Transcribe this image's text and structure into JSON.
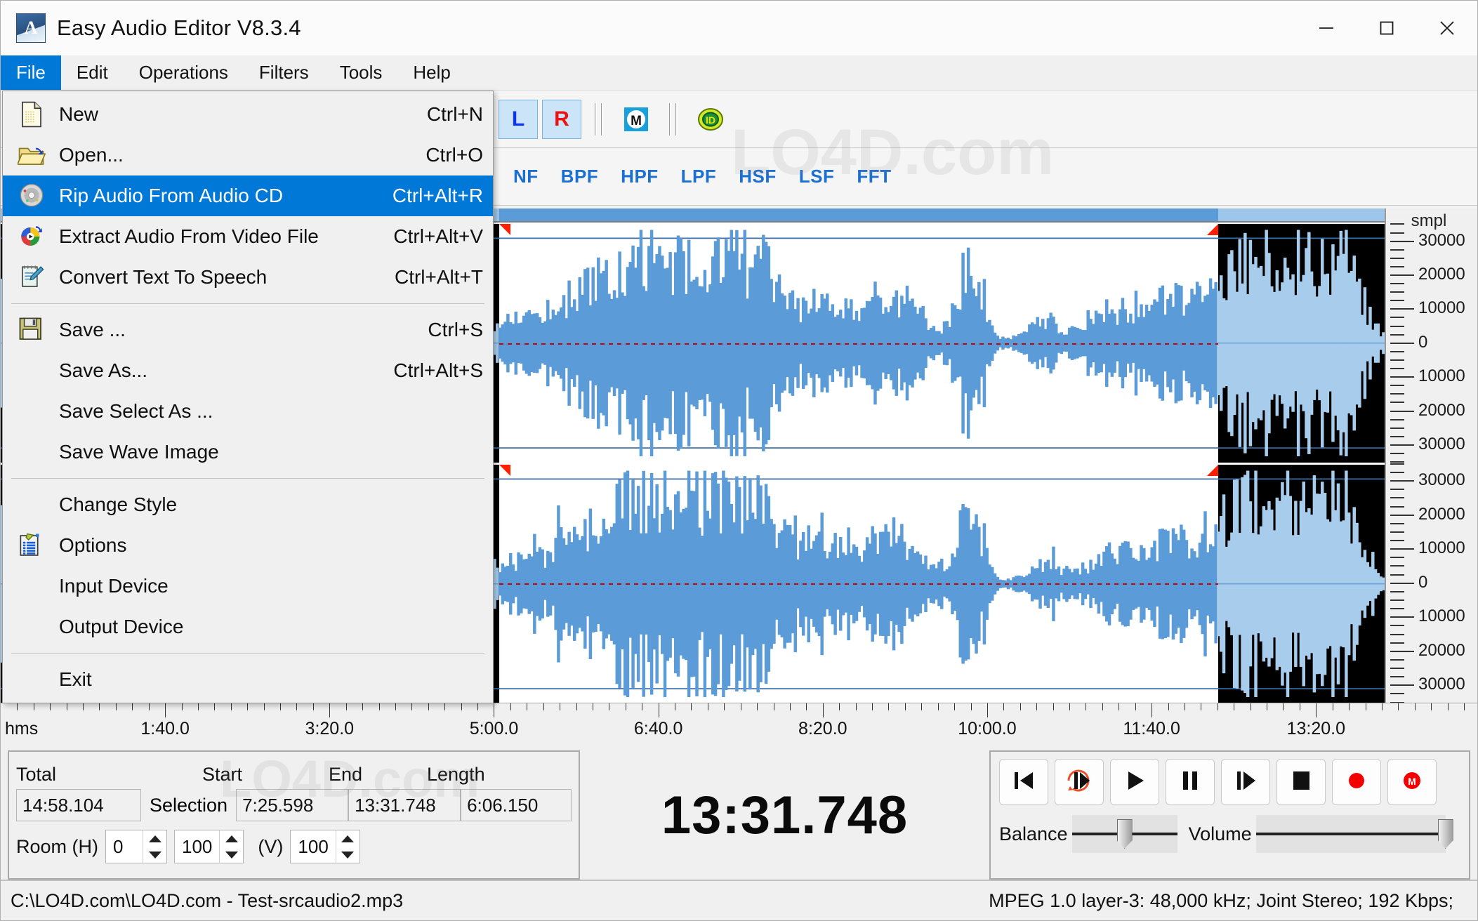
{
  "window": {
    "title": "Easy Audio Editor V8.3.4",
    "app_icon": "A",
    "minimize_icon": "minimize-icon",
    "maximize_icon": "maximize-icon",
    "close_icon": "close-icon"
  },
  "menubar": {
    "items": [
      {
        "label": "File",
        "active": true
      },
      {
        "label": "Edit",
        "active": false
      },
      {
        "label": "Operations",
        "active": false
      },
      {
        "label": "Filters",
        "active": false
      },
      {
        "label": "Tools",
        "active": false
      },
      {
        "label": "Help",
        "active": false
      }
    ]
  },
  "file_menu": {
    "open": true,
    "items": [
      {
        "type": "item",
        "icon": "new-document-icon",
        "label": "New",
        "accel": "Ctrl+N",
        "selected": false
      },
      {
        "type": "item",
        "icon": "open-folder-icon",
        "label": "Open...",
        "accel": "Ctrl+O",
        "selected": false
      },
      {
        "type": "item",
        "icon": "audio-cd-icon",
        "label": "Rip Audio From Audio CD",
        "accel": "Ctrl+Alt+R",
        "selected": true
      },
      {
        "type": "item",
        "icon": "video-file-icon",
        "label": "Extract Audio From Video File",
        "accel": "Ctrl+Alt+V",
        "selected": false
      },
      {
        "type": "item",
        "icon": "text-to-speech-icon",
        "label": "Convert Text To Speech",
        "accel": "Ctrl+Alt+T",
        "selected": false
      },
      {
        "type": "separator"
      },
      {
        "type": "item",
        "icon": "floppy-save-icon",
        "label": "Save ...",
        "accel": "Ctrl+S",
        "selected": false
      },
      {
        "type": "item",
        "icon": "",
        "label": "Save As...",
        "accel": "Ctrl+Alt+S",
        "selected": false
      },
      {
        "type": "item",
        "icon": "",
        "label": "Save Select As ...",
        "accel": "",
        "selected": false
      },
      {
        "type": "item",
        "icon": "",
        "label": "Save Wave Image",
        "accel": "",
        "selected": false
      },
      {
        "type": "separator"
      },
      {
        "type": "item",
        "icon": "",
        "label": "Change Style",
        "accel": "",
        "selected": false
      },
      {
        "type": "item",
        "icon": "options-list-icon",
        "label": "Options",
        "accel": "",
        "selected": false
      },
      {
        "type": "item",
        "icon": "",
        "label": "Input Device",
        "accel": "",
        "selected": false
      },
      {
        "type": "item",
        "icon": "",
        "label": "Output Device",
        "accel": "",
        "selected": false
      },
      {
        "type": "separator"
      },
      {
        "type": "item",
        "icon": "",
        "label": "Exit",
        "accel": "",
        "selected": false
      }
    ]
  },
  "toolbar_row1": [
    {
      "kind": "icon",
      "name": "paste-icon"
    },
    {
      "kind": "icon",
      "name": "paste-new-icon"
    },
    {
      "kind": "sep"
    },
    {
      "kind": "icon",
      "name": "undo-icon"
    },
    {
      "kind": "icon",
      "name": "redo-icon"
    },
    {
      "kind": "sep"
    },
    {
      "kind": "icon",
      "name": "zoom-in-icon"
    },
    {
      "kind": "icon",
      "name": "zoom-out-icon"
    },
    {
      "kind": "icon",
      "name": "zoom-selection-icon"
    },
    {
      "kind": "sep3"
    },
    {
      "kind": "icon",
      "name": "batch-convert-icon"
    },
    {
      "kind": "icon",
      "name": "cd-burn-c-icon"
    },
    {
      "kind": "sep3"
    },
    {
      "kind": "label",
      "name": "left-channel-toggle",
      "text": "L",
      "style": "l",
      "pressed": true
    },
    {
      "kind": "label",
      "name": "right-channel-toggle",
      "text": "R",
      "style": "r",
      "pressed": true
    },
    {
      "kind": "sep3"
    },
    {
      "kind": "icon",
      "name": "mono-mix-icon"
    },
    {
      "kind": "sep3"
    },
    {
      "kind": "icon",
      "name": "id3-tag-icon"
    }
  ],
  "toolbar_row2": [
    {
      "kind": "sep3"
    },
    {
      "kind": "icon",
      "name": "normalize-icon"
    },
    {
      "kind": "icon",
      "name": "amplify-icon"
    },
    {
      "kind": "icon",
      "name": "fade-icon"
    },
    {
      "kind": "icon",
      "name": "echo-icon"
    },
    {
      "kind": "icon",
      "name": "reverb-icon"
    },
    {
      "kind": "icon",
      "name": "invert-icon"
    },
    {
      "kind": "icon",
      "name": "reverse-icon"
    },
    {
      "kind": "icon",
      "name": "equalizer-icon"
    },
    {
      "kind": "icon",
      "name": "flanger-icon"
    },
    {
      "kind": "icon",
      "name": "chorus-icon"
    },
    {
      "kind": "sep3"
    },
    {
      "kind": "text",
      "name": "notch-filter-button",
      "text": "NF"
    },
    {
      "kind": "text",
      "name": "bandpass-filter-button",
      "text": "BPF"
    },
    {
      "kind": "text",
      "name": "highpass-filter-button",
      "text": "HPF"
    },
    {
      "kind": "text",
      "name": "lowpass-filter-button",
      "text": "LPF"
    },
    {
      "kind": "text",
      "name": "highshelf-filter-button",
      "text": "HSF"
    },
    {
      "kind": "text",
      "name": "lowshelf-filter-button",
      "text": "LSF"
    },
    {
      "kind": "text",
      "name": "fft-filter-button",
      "text": "FFT"
    }
  ],
  "waveform": {
    "vertical_axis": {
      "unit": "smpl",
      "labels": [
        "30000",
        "20000",
        "10000",
        "0",
        "10000",
        "20000",
        "30000"
      ]
    },
    "time_axis": {
      "unit": "hms",
      "labels": [
        "1:40.0",
        "3:20.0",
        "5:00.0",
        "6:40.0",
        "8:20.0",
        "10:00.0",
        "11:40.0",
        "13:20.0"
      ]
    },
    "selection": {
      "start_pct": 36.0,
      "end_pct": 88.0
    },
    "colors": {
      "wave_unselected": "#a8cdec",
      "wave_selected": "#5a9bd8",
      "background_unselected": "#000000",
      "background_selected": "#ffffff",
      "marker": "#ff2000",
      "strip": "#9ec6ea",
      "strip_selected": "#5a9bd8"
    }
  },
  "info_panel": {
    "total_label": "Total",
    "total_value": "14:58.104",
    "selection_label": "Selection",
    "start_label": "Start",
    "start_value": "7:25.598",
    "end_label": "End",
    "end_value": "13:31.748",
    "length_label": "Length",
    "length_value": "6:06.150",
    "room_label": "Room (H)",
    "room_h1": "0",
    "room_h2": "100",
    "room_v_label": "(V)",
    "room_v": "100"
  },
  "time_display": {
    "value": "13:31.748"
  },
  "transport": {
    "buttons": [
      {
        "name": "go-to-start-button",
        "icon": "skip-back-icon"
      },
      {
        "name": "play-selection-button",
        "icon": "play-loop-icon"
      },
      {
        "name": "play-button",
        "icon": "play-icon"
      },
      {
        "name": "pause-button",
        "icon": "pause-icon"
      },
      {
        "name": "play-forward-button",
        "icon": "step-forward-icon"
      },
      {
        "name": "stop-button",
        "icon": "stop-icon"
      },
      {
        "name": "record-button",
        "icon": "record-icon"
      },
      {
        "name": "record-monitor-button",
        "icon": "record-m-icon"
      }
    ],
    "balance_label": "Balance",
    "balance_pct": 50,
    "volume_label": "Volume",
    "volume_pct": 100
  },
  "statusbar": {
    "file_path": "C:\\LO4D.com\\LO4D.com - Test-srcaudio2.mp3",
    "format_info": "MPEG 1.0 layer-3: 48,000 kHz; Joint Stereo; 192 Kbps;"
  },
  "watermark": {
    "text": "LO4D.com"
  }
}
